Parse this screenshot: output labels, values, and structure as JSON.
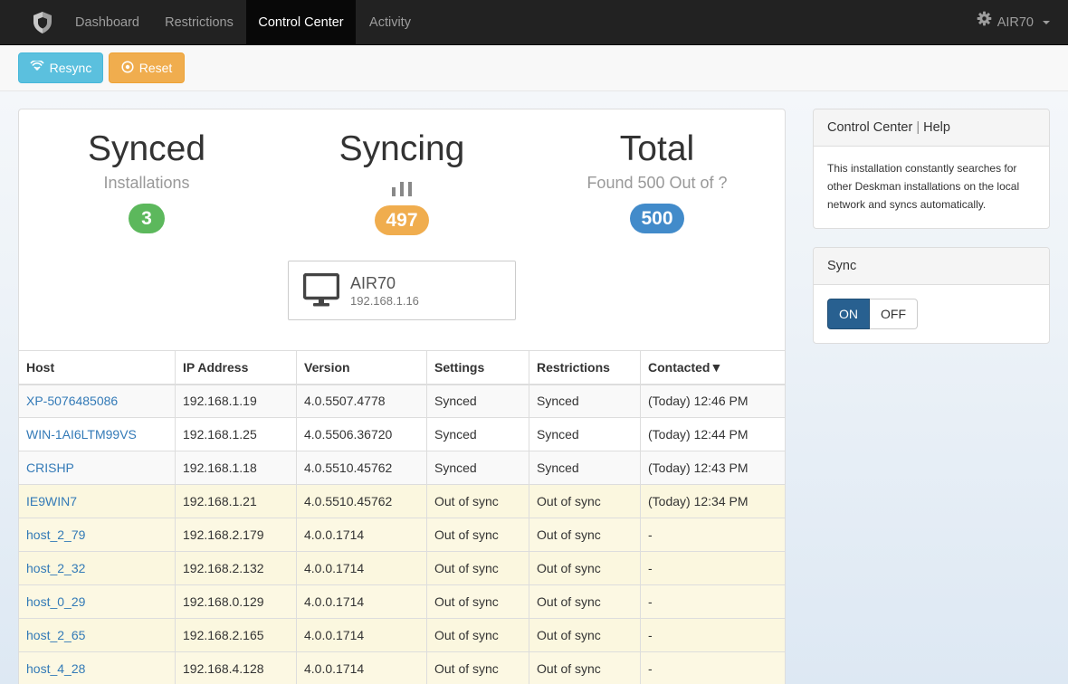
{
  "navbar": {
    "brand_icon": "shield-icon",
    "items": [
      {
        "label": "Dashboard",
        "active": false
      },
      {
        "label": "Restrictions",
        "active": false
      },
      {
        "label": "Control Center",
        "active": true
      },
      {
        "label": "Activity",
        "active": false
      }
    ],
    "user": {
      "icon": "gear-icon",
      "label": "AIR70"
    }
  },
  "toolbar": {
    "resync_label": "Resync",
    "resync_icon": "signal-icon",
    "reset_label": "Reset",
    "reset_icon": "target-icon"
  },
  "stats": {
    "synced": {
      "title": "Synced",
      "subtitle": "Installations",
      "count": "3"
    },
    "syncing": {
      "title": "Syncing",
      "count": "497"
    },
    "total": {
      "title": "Total",
      "subtitle": "Found 500 Out of ?",
      "count": "500"
    }
  },
  "current_host": {
    "icon": "monitor-icon",
    "name": "AIR70",
    "ip": "192.168.1.16"
  },
  "table": {
    "columns": [
      "Host",
      "IP Address",
      "Version",
      "Settings",
      "Restrictions",
      "Contacted▼"
    ],
    "rows": [
      {
        "host": "XP-5076485086",
        "ip": "192.168.1.19",
        "version": "4.0.5507.4778",
        "settings": "Synced",
        "restrictions": "Synced",
        "contacted": "(Today) 12:46 PM"
      },
      {
        "host": "WIN-1AI6LTM99VS",
        "ip": "192.168.1.25",
        "version": "4.0.5506.36720",
        "settings": "Synced",
        "restrictions": "Synced",
        "contacted": "(Today) 12:44 PM"
      },
      {
        "host": "CRISHP",
        "ip": "192.168.1.18",
        "version": "4.0.5510.45762",
        "settings": "Synced",
        "restrictions": "Synced",
        "contacted": "(Today) 12:43 PM"
      },
      {
        "host": "IE9WIN7",
        "ip": "192.168.1.21",
        "version": "4.0.5510.45762",
        "settings": "Out of sync",
        "restrictions": "Out of sync",
        "contacted": "(Today) 12:34 PM"
      },
      {
        "host": "host_2_79",
        "ip": "192.168.2.179",
        "version": "4.0.0.1714",
        "settings": "Out of sync",
        "restrictions": "Out of sync",
        "contacted": "-"
      },
      {
        "host": "host_2_32",
        "ip": "192.168.2.132",
        "version": "4.0.0.1714",
        "settings": "Out of sync",
        "restrictions": "Out of sync",
        "contacted": "-"
      },
      {
        "host": "host_0_29",
        "ip": "192.168.0.129",
        "version": "4.0.0.1714",
        "settings": "Out of sync",
        "restrictions": "Out of sync",
        "contacted": "-"
      },
      {
        "host": "host_2_65",
        "ip": "192.168.2.165",
        "version": "4.0.0.1714",
        "settings": "Out of sync",
        "restrictions": "Out of sync",
        "contacted": "-"
      },
      {
        "host": "host_4_28",
        "ip": "192.168.4.128",
        "version": "4.0.0.1714",
        "settings": "Out of sync",
        "restrictions": "Out of sync",
        "contacted": "-"
      }
    ]
  },
  "help_panel": {
    "title": "Control Center",
    "separator": "|",
    "help_link": "Help",
    "body": "This installation constantly searches for other Deskman installations on the local network and syncs automatically."
  },
  "sync_panel": {
    "title": "Sync",
    "on_label": "ON",
    "off_label": "OFF",
    "state": "ON"
  },
  "colors": {
    "synced": "#5cb85c",
    "syncing": "#f0ad4e",
    "total": "#428bca",
    "link": "#337ab7"
  }
}
